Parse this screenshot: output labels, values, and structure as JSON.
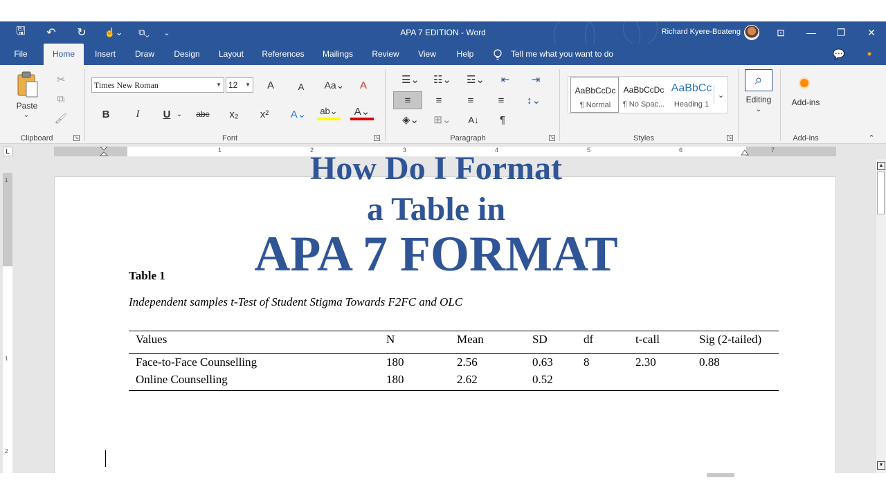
{
  "titlebar": {
    "doc_title": "APA 7 EDITION  -  Word",
    "user_name": "Richard Kyere-Boateng",
    "qat": {
      "save": "🖫",
      "undo": "↶",
      "redo": "↻",
      "touch": "☝⌄",
      "format": "⧉⌄",
      "customize": "⌄"
    },
    "window": {
      "ribbon_options": "⊡",
      "minimize": "—",
      "restore": "❐",
      "close": "✕"
    }
  },
  "tabs": {
    "file": "File",
    "home": "Home",
    "insert": "Insert",
    "draw": "Draw",
    "design": "Design",
    "layout": "Layout",
    "references": "References",
    "mailings": "Mailings",
    "review": "Review",
    "view": "View",
    "help": "Help",
    "tell_me": "Tell me what you want to do",
    "comments_glyph": "💬",
    "dot_glyph": "•"
  },
  "ribbon": {
    "clipboard": {
      "paste": "Paste",
      "paste_arrow": "⌄",
      "cut": "✂",
      "copy": "⧉",
      "format_painter": "🖌",
      "label": "Clipboard"
    },
    "font": {
      "name": "Times New Roman",
      "size": "12",
      "grow": "A",
      "shrink": "A",
      "change_case": "Aa⌄",
      "clear": "A",
      "bold": "B",
      "italic": "I",
      "underline": "U",
      "underline_arrow": "⌄",
      "strike": "abc",
      "subscript": "x₂",
      "superscript": "x²",
      "text_effects": "A⌄",
      "highlight": "ab⌄",
      "font_color": "A⌄",
      "label": "Font"
    },
    "paragraph": {
      "bullets": "☰⌄",
      "numbering": "☷⌄",
      "multilevel": "☲⌄",
      "decrease_indent": "⇤",
      "increase_indent": "⇥",
      "align_left": "≡",
      "center": "≡",
      "align_right": "≡",
      "justify": "≡",
      "line_spacing": "↕⌄",
      "shading": "◈⌄",
      "borders": "⊞⌄",
      "sort": "A↓",
      "pilcrow": "¶",
      "label": "Paragraph"
    },
    "styles": {
      "items": [
        {
          "sample": "AaBbCcDc",
          "name": "¶ Normal"
        },
        {
          "sample": "AaBbCcDc",
          "name": "¶ No Spac..."
        },
        {
          "sample": "AaBbCc",
          "name": "Heading 1"
        }
      ],
      "more": "⌄",
      "label": "Styles"
    },
    "editing": {
      "label": "Editing",
      "arrow": "⌄",
      "glyph": "⌕"
    },
    "addins": {
      "button": "Add-ins",
      "label": "Add-ins"
    },
    "collapse": "⌃",
    "launcher": "↘"
  },
  "ruler": {
    "tab_selector": "L",
    "numbers": [
      "1",
      "2",
      "3",
      "4",
      "5",
      "6",
      "7"
    ],
    "vnumbers": [
      "1",
      "1",
      "2"
    ]
  },
  "headline": {
    "line1": "How Do I Format",
    "line2": "a Table in",
    "line3": "APA 7 FORMAT"
  },
  "document": {
    "table_label": "Table 1",
    "table_caption": "Independent samples t-Test of Student Stigma Towards F2FC and OLC",
    "table": {
      "headers": [
        "Values",
        "N",
        "Mean",
        "SD",
        "df",
        "t-call",
        "Sig (2-tailed)"
      ],
      "rows": [
        [
          "Face-to-Face Counselling",
          "180",
          "2.56",
          "0.63",
          "8",
          "2.30",
          "0.88"
        ],
        [
          "Online Counselling",
          "180",
          "2.62",
          "0.52",
          "",
          "",
          ""
        ]
      ]
    }
  },
  "scrollbar": {
    "up": "▲",
    "down": "▼"
  },
  "colors": {
    "word_blue": "#2b579a",
    "headline_blue": "#2f5597",
    "ribbon_bg": "#f3f3f3"
  }
}
